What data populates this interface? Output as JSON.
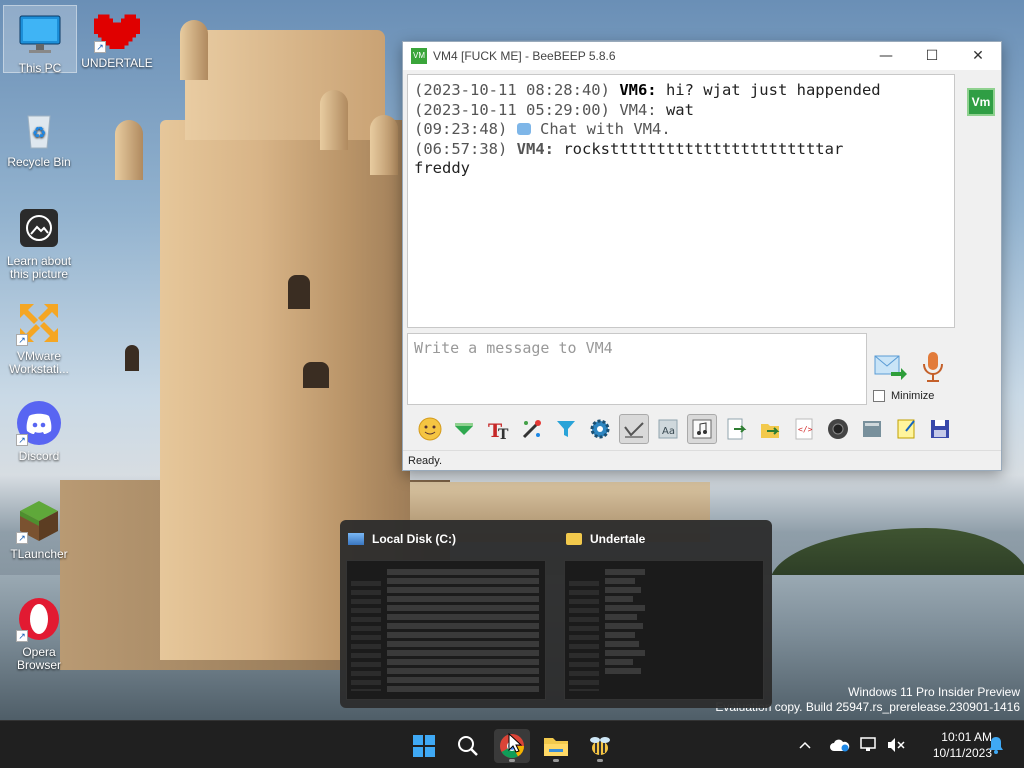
{
  "desktop": {
    "icons": [
      {
        "label": "This PC"
      },
      {
        "label": "UNDERTALE"
      },
      {
        "label": "Recycle Bin"
      },
      {
        "label": "Learn about this picture"
      },
      {
        "label": "VMware Workstati..."
      },
      {
        "label": "Discord"
      },
      {
        "label": "TLauncher"
      },
      {
        "label": "Opera Browser"
      }
    ],
    "watermark": {
      "line1": "Windows 11 Pro Insider Preview",
      "line2": "Evaluation copy. Build 25947.rs_prerelease.230901-1416"
    }
  },
  "window": {
    "title": "VM4 [FUCK ME] - BeeBEEP 5.8.6",
    "app_badge": "VM",
    "controls": {
      "minimize": "—",
      "maximize": "☐",
      "close": "✕"
    },
    "chat": [
      {
        "time": "(2023-10-11 08:28:40)",
        "user": "VM6:",
        "text": " hi? wjat just happended"
      },
      {
        "time": "(2023-10-11 05:29:00)",
        "user": "VM4:",
        "text": " wat"
      },
      {
        "time": "(09:23:48)",
        "user": "",
        "text": " Chat with VM4."
      },
      {
        "time": "(06:57:38)",
        "user": "VM4:",
        "text": " rockstttttttttttttttttttttttar"
      },
      {
        "time": "",
        "user": "",
        "text": "freddy"
      }
    ],
    "avatar": "Vm",
    "input_placeholder": "Write a message to VM4",
    "minimize_label": "Minimize",
    "status": "Ready.",
    "toolbar_icons": [
      "emoticons-icon",
      "bullet-icon",
      "text-format-icon",
      "color-picker-icon",
      "filter-icon",
      "settings-icon",
      "spellcheck-icon",
      "font-icon",
      "music-note-icon",
      "export-icon",
      "send-file-icon",
      "html-icon",
      "screenshot-icon",
      "clear-icon",
      "notes-icon",
      "save-icon"
    ]
  },
  "preview": {
    "cards": [
      {
        "title": "Local Disk (C:)"
      },
      {
        "title": "Undertale"
      }
    ]
  },
  "taskbar": {
    "time": "10:01 AM",
    "date": "10/11/2023"
  }
}
